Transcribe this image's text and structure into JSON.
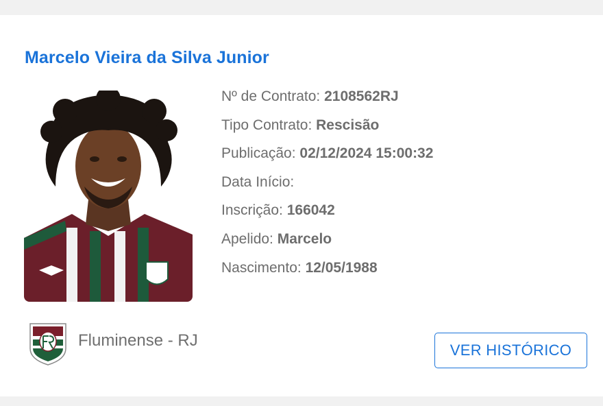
{
  "player": {
    "name": "Marcelo Vieira da Silva Junior"
  },
  "fields": [
    {
      "label": "Nº de Contrato:",
      "value": "2108562RJ"
    },
    {
      "label": "Tipo Contrato:",
      "value": "Rescisão"
    },
    {
      "label": "Publicação:",
      "value": "02/12/2024 15:00:32"
    },
    {
      "label": "Data Início:",
      "value": ""
    },
    {
      "label": "Inscrição:",
      "value": "166042"
    },
    {
      "label": "Apelido:",
      "value": "Marcelo"
    },
    {
      "label": "Nascimento:",
      "value": "12/05/1988"
    }
  ],
  "club": {
    "name": "Fluminense - RJ",
    "crest_icon": "fluminense-crest-icon",
    "colors": [
      "#7a1f2b",
      "#1f5f3a",
      "#ffffff"
    ]
  },
  "actions": {
    "history_label": "VER HISTÓRICO"
  },
  "theme": {
    "accent": "#1a73d9",
    "text": "#6d6d6d",
    "background": "#f1f1f1"
  }
}
